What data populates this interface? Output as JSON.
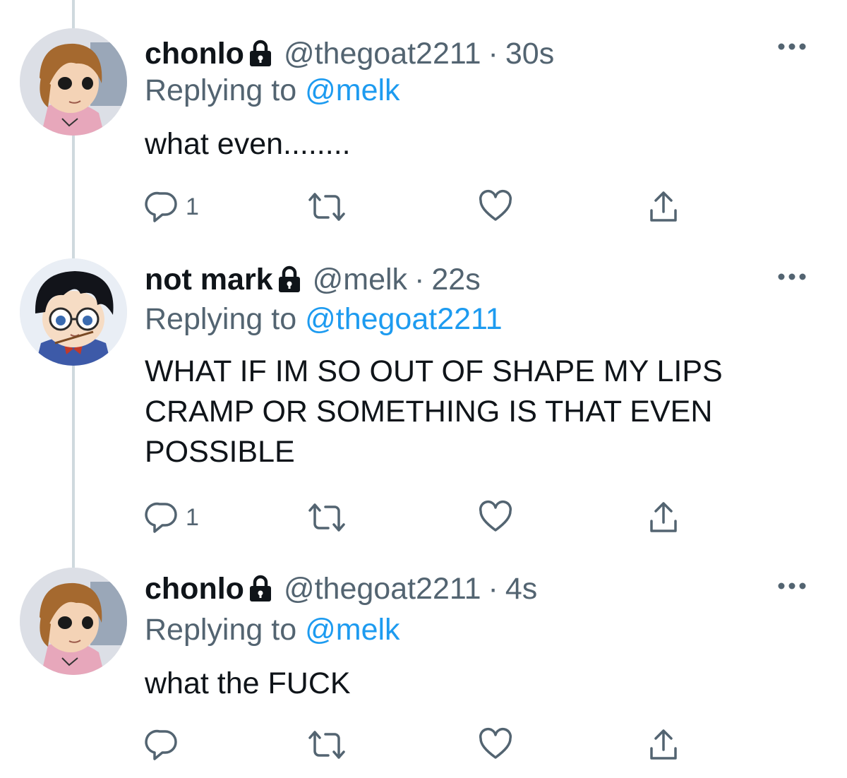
{
  "tweets": [
    {
      "name": "chonlo",
      "handle": "@thegoat2211",
      "separator": "·",
      "time": "30s",
      "replying_prefix": "Replying to",
      "replying_handle": "@melk",
      "text": "what even........",
      "reply_count": "1",
      "avatar": "avatar-brown-hair-character"
    },
    {
      "name": "not mark",
      "handle": "@melk",
      "separator": "·",
      "time": "22s",
      "replying_prefix": "Replying to",
      "replying_handle": "@thegoat2211",
      "text": "WHAT IF IM SO OUT OF SHAPE MY LIPS\nCRAMP OR SOMETHING IS THAT EVEN\nPOSSIBLE",
      "reply_count": "1",
      "avatar": "avatar-glasses-character"
    },
    {
      "name": "chonlo",
      "handle": "@thegoat2211",
      "separator": "·",
      "time": "4s",
      "replying_prefix": "Replying to",
      "replying_handle": "@melk",
      "text": "what the FUCK",
      "reply_count": "",
      "avatar": "avatar-brown-hair-character"
    }
  ],
  "icons": {
    "lock": "lock-icon",
    "reply": "reply-icon",
    "retweet": "retweet-icon",
    "like": "heart-icon",
    "share": "share-icon",
    "more": "more-icon"
  },
  "colors": {
    "link": "#1d9bf0",
    "secondary_text": "#536471",
    "primary_text": "#0f1419",
    "thread_line": "#cfd9de"
  }
}
